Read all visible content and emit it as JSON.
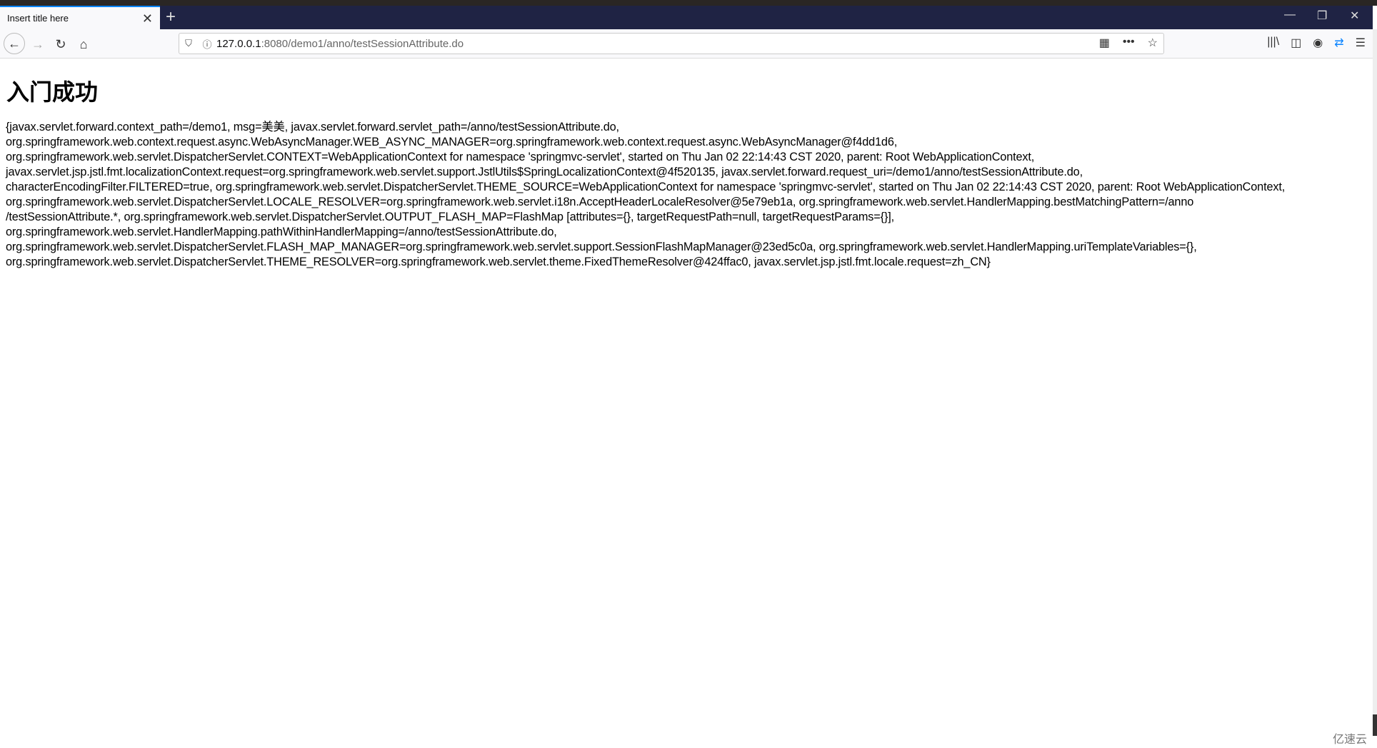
{
  "browser": {
    "tab_title": "Insert title here",
    "url_host": "127.0.0.1",
    "url_rest": ":8080/demo1/anno/testSessionAttribute.do",
    "accent": "#0a84ff"
  },
  "page": {
    "heading": "入门成功",
    "lines": [
      "{javax.servlet.forward.context_path=/demo1, msg=美美, javax.servlet.forward.servlet_path=/anno/testSessionAttribute.do,",
      "org.springframework.web.context.request.async.WebAsyncManager.WEB_ASYNC_MANAGER=org.springframework.web.context.request.async.WebAsyncManager@f4dd1d6,",
      "org.springframework.web.servlet.DispatcherServlet.CONTEXT=WebApplicationContext for namespace 'springmvc-servlet', started on Thu Jan 02 22:14:43 CST 2020, parent: Root WebApplicationContext,",
      "javax.servlet.jsp.jstl.fmt.localizationContext.request=org.springframework.web.servlet.support.JstlUtils$SpringLocalizationContext@4f520135, javax.servlet.forward.request_uri=/demo1/anno/testSessionAttribute.do,",
      "characterEncodingFilter.FILTERED=true, org.springframework.web.servlet.DispatcherServlet.THEME_SOURCE=WebApplicationContext for namespace 'springmvc-servlet', started on Thu Jan 02 22:14:43 CST 2020, parent: Root WebApplicationContext,",
      "org.springframework.web.servlet.DispatcherServlet.LOCALE_RESOLVER=org.springframework.web.servlet.i18n.AcceptHeaderLocaleResolver@5e79eb1a, org.springframework.web.servlet.HandlerMapping.bestMatchingPattern=/anno",
      "/testSessionAttribute.*, org.springframework.web.servlet.DispatcherServlet.OUTPUT_FLASH_MAP=FlashMap [attributes={}, targetRequestPath=null, targetRequestParams={}],",
      "org.springframework.web.servlet.HandlerMapping.pathWithinHandlerMapping=/anno/testSessionAttribute.do,",
      "org.springframework.web.servlet.DispatcherServlet.FLASH_MAP_MANAGER=org.springframework.web.servlet.support.SessionFlashMapManager@23ed5c0a, org.springframework.web.servlet.HandlerMapping.uriTemplateVariables={},",
      "org.springframework.web.servlet.DispatcherServlet.THEME_RESOLVER=org.springframework.web.servlet.theme.FixedThemeResolver@424ffac0, javax.servlet.jsp.jstl.fmt.locale.request=zh_CN}"
    ]
  },
  "watermark": "亿速云"
}
